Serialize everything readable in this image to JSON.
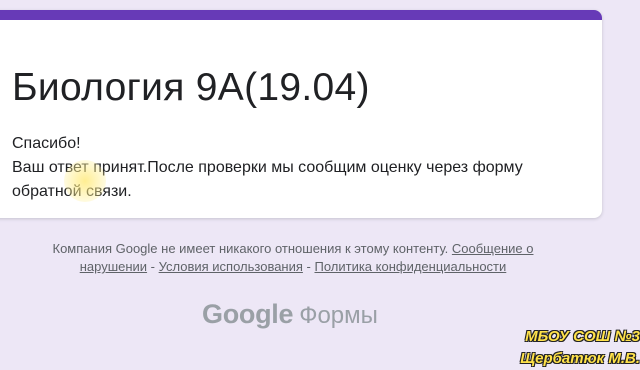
{
  "form": {
    "title": "Биология 9А(19.04)",
    "thanks": "Спасибо!",
    "response_line1": "Ваш ответ принят.После проверки мы сообщим оценку через форму",
    "response_line2": "обратной связи."
  },
  "footer": {
    "disclaimer_text": "Компания Google не имеет никакого отношения к этому контенту. ",
    "report_link_part1": "Сообщение о",
    "report_link_part2": "нарушении",
    "separator": " - ",
    "terms_link": "Условия использования",
    "privacy_link": "Политика конфиденциальности"
  },
  "brand": {
    "google": "Google",
    "forms": "Формы"
  },
  "watermark": {
    "line1": "МБОУ СОШ №3",
    "line2": "Щербатюк М.В."
  },
  "colors": {
    "accent": "#673ab7",
    "background": "#ede7f6",
    "card": "#ffffff",
    "watermark": "#ffe24a"
  }
}
